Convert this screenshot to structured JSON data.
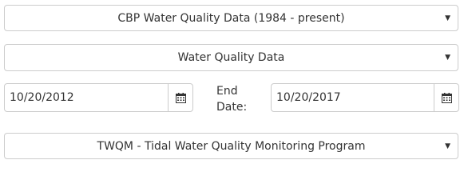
{
  "database_select": {
    "value": "CBP Water Quality Data (1984 - present)"
  },
  "data_type_select": {
    "value": "Water Quality Data"
  },
  "date_range": {
    "start_value": "10/20/2012",
    "end_label": "End Date:",
    "end_value": "10/20/2017"
  },
  "program_select": {
    "value": "TWQM - Tidal Water Quality Monitoring Program"
  },
  "icons": {
    "caret": "caret-down-icon",
    "calendar": "calendar-icon"
  }
}
